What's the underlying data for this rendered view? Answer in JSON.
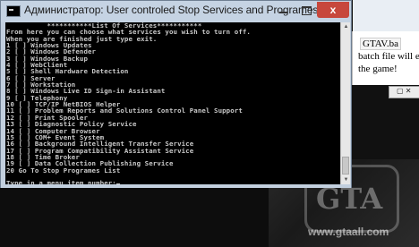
{
  "window": {
    "title": "Администратор:  User controled Stop Services and Programes Script",
    "close_label": "x"
  },
  "console": {
    "lines": [
      "          ***********List Of Services***********",
      "From here you can choose what services you wish to turn off.",
      "When you are finished just type exit.",
      "1 [ ] Windows Updates",
      "2 [ ] Windows Defender",
      "3 [ ] Windows Backup",
      "4 [ ] WebClient",
      "5 [ ] Shell Hardware Detection",
      "6 [ ] Server",
      "7 [ ] Workstation",
      "8 [ ] Windows Live ID Sign-in Assistant",
      "9 [ ] Telephony",
      "10 [ ] TCP/IP NetBIOS Helper",
      "11 [ ] Problem Reports and Solutions Control Panel Support",
      "12 [ ] Print Spooler",
      "13 [ ] Diagnostic Policy Service",
      "14 [ ] Computer Browser",
      "15 [ ] COM+ Event System",
      "16 [ ] Background Intelligent Transfer Service",
      "17 [ ] Program Compatibility Assistant Service",
      "18 [ ] Time Broker",
      "19 [ ] Data Collection Publishing Service",
      "20 Go To Stop Programes List",
      "",
      "Type in a menu item number:"
    ]
  },
  "background": {
    "file_label": "GTAV.ba",
    "text_line1": "batch file will end u",
    "text_line2": "the game!",
    "site_url": "www.gtaall.com",
    "logo_text": "GTA"
  },
  "colors": {
    "console_bg": "#000000",
    "console_text": "#c9c9c9",
    "titlebar": "#c5d3e3",
    "close": "#c7473c"
  }
}
